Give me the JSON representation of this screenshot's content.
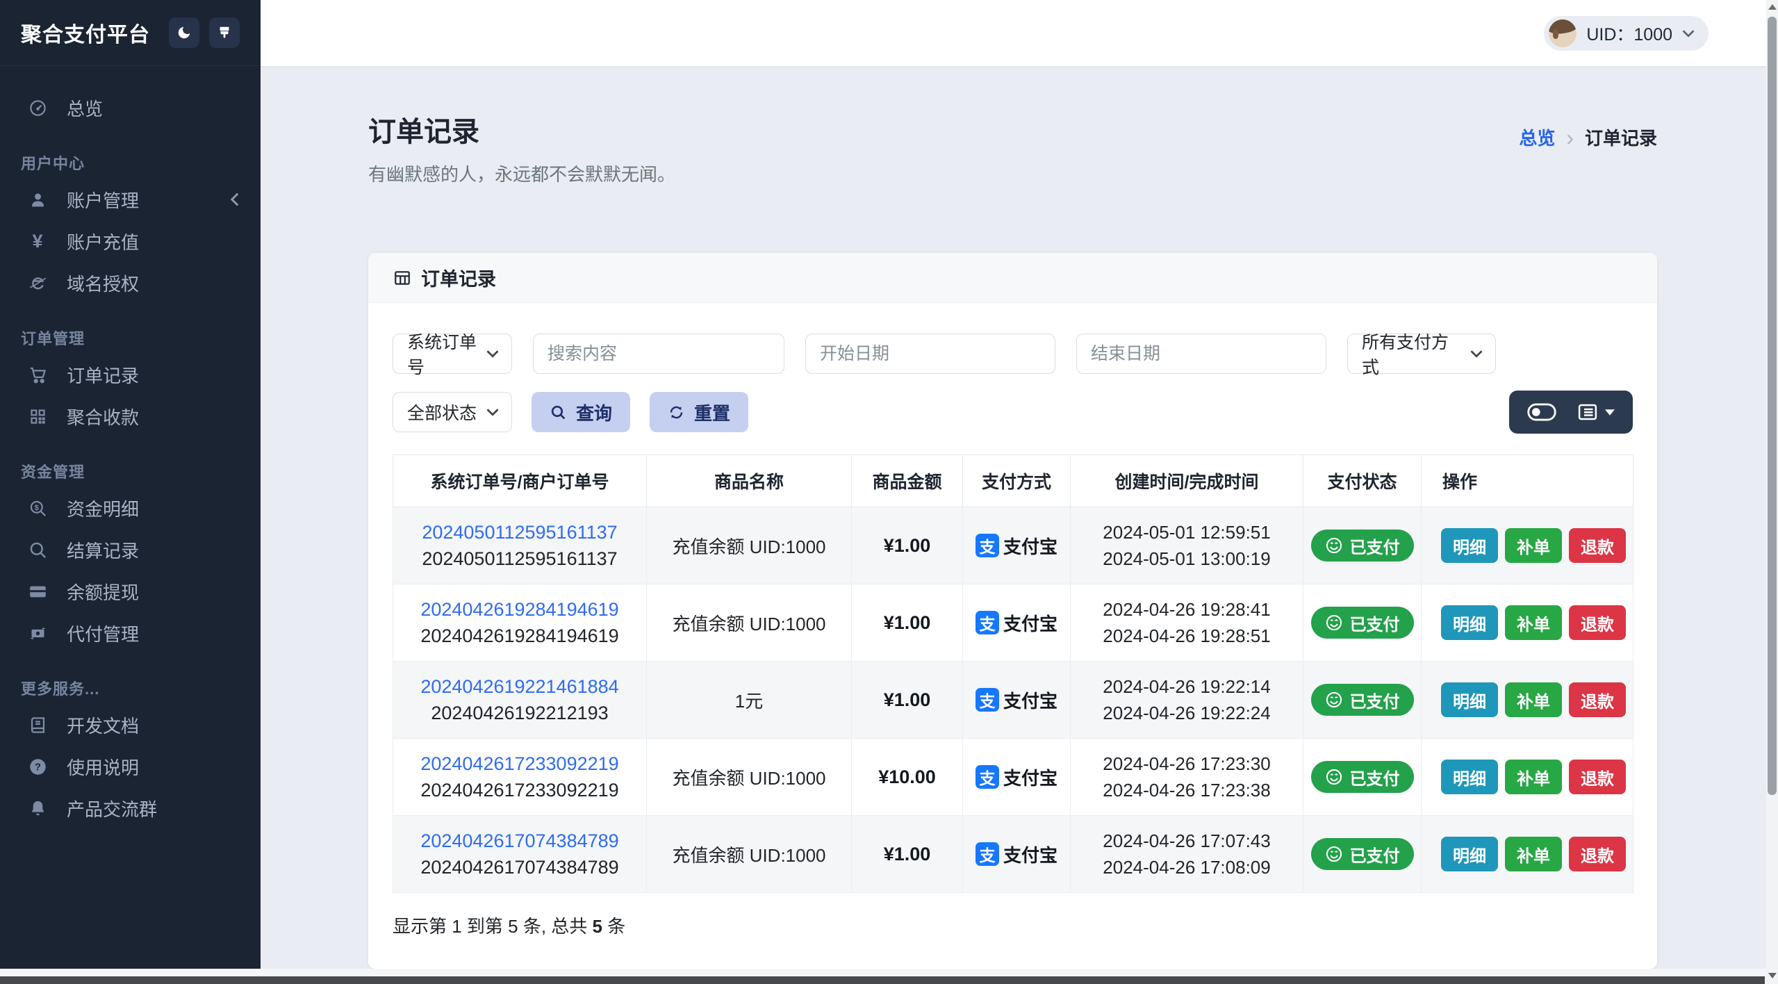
{
  "app": {
    "title": "聚合支付平台"
  },
  "topbar": {
    "uid_label": "UID：1000"
  },
  "sidebar": {
    "sections": [
      {
        "label": "",
        "items": [
          {
            "id": "overview",
            "icon": "gauge-icon",
            "label": "总览"
          }
        ]
      },
      {
        "label": "用户中心",
        "items": [
          {
            "id": "account-management",
            "icon": "user-icon",
            "label": "账户管理",
            "collapsible": true
          },
          {
            "id": "account-recharge",
            "icon": "yen-icon",
            "label": "账户充值"
          },
          {
            "id": "domain-authorization",
            "icon": "globe-icon",
            "label": "域名授权"
          }
        ]
      },
      {
        "label": "订单管理",
        "items": [
          {
            "id": "order-records",
            "icon": "cart-icon",
            "label": "订单记录"
          },
          {
            "id": "aggregate-collection",
            "icon": "qrcode-icon",
            "label": "聚合收款"
          }
        ]
      },
      {
        "label": "资金管理",
        "items": [
          {
            "id": "funds-detail",
            "icon": "search-dollar-icon",
            "label": "资金明细"
          },
          {
            "id": "settlement-records",
            "icon": "search-icon",
            "label": "结算记录"
          },
          {
            "id": "balance-withdrawal",
            "icon": "card-icon",
            "label": "余额提现"
          },
          {
            "id": "payout-management",
            "icon": "transfer-icon",
            "label": "代付管理"
          }
        ]
      },
      {
        "label": "更多服务...",
        "items": [
          {
            "id": "dev-docs",
            "icon": "book-icon",
            "label": "开发文档"
          },
          {
            "id": "usage-guide",
            "icon": "question-icon",
            "label": "使用说明"
          },
          {
            "id": "product-chat-group",
            "icon": "bell-icon",
            "label": "产品交流群"
          }
        ]
      }
    ]
  },
  "page": {
    "title": "订单记录",
    "subtitle": "有幽默感的人，永远都不会默默无闻。",
    "breadcrumb_parent": "总览",
    "breadcrumb_current": "订单记录"
  },
  "card": {
    "title": "订单记录"
  },
  "filters": {
    "search_type": "系统订单号",
    "search_placeholder": "搜索内容",
    "start_date_placeholder": "开始日期",
    "end_date_placeholder": "结束日期",
    "pay_method": "所有支付方式",
    "status": "全部状态",
    "query_label": "查询",
    "reset_label": "重置"
  },
  "table": {
    "headers": [
      "系统订单号/商户订单号",
      "商品名称",
      "商品金额",
      "支付方式",
      "创建时间/完成时间",
      "支付状态",
      "操作"
    ],
    "rows": [
      {
        "sys_no": "2024050112595161137",
        "merchant_no": "2024050112595161137",
        "product": "充值余额 UID:1000",
        "amount": "¥1.00",
        "method": "支付宝",
        "created": "2024-05-01 12:59:51",
        "completed": "2024-05-01 13:00:19",
        "status": "已支付"
      },
      {
        "sys_no": "2024042619284194619",
        "merchant_no": "2024042619284194619",
        "product": "充值余额 UID:1000",
        "amount": "¥1.00",
        "method": "支付宝",
        "created": "2024-04-26 19:28:41",
        "completed": "2024-04-26 19:28:51",
        "status": "已支付"
      },
      {
        "sys_no": "2024042619221461884",
        "merchant_no": "20240426192212193",
        "product": "1元",
        "amount": "¥1.00",
        "method": "支付宝",
        "created": "2024-04-26 19:22:14",
        "completed": "2024-04-26 19:22:24",
        "status": "已支付"
      },
      {
        "sys_no": "2024042617233092219",
        "merchant_no": "2024042617233092219",
        "product": "充值余额 UID:1000",
        "amount": "¥10.00",
        "method": "支付宝",
        "created": "2024-04-26 17:23:30",
        "completed": "2024-04-26 17:23:38",
        "status": "已支付"
      },
      {
        "sys_no": "2024042617074384789",
        "merchant_no": "2024042617074384789",
        "product": "充值余额 UID:1000",
        "amount": "¥1.00",
        "method": "支付宝",
        "created": "2024-04-26 17:07:43",
        "completed": "2024-04-26 17:08:09",
        "status": "已支付"
      }
    ],
    "actions": [
      "明细",
      "补单",
      "退款"
    ],
    "alipay_glyph": "支",
    "footer": {
      "prefix": "显示第 1 到第 5 条, 总共 ",
      "total": "5",
      "suffix": " 条"
    }
  },
  "colors": {
    "sidebar_bg": "#1b2433",
    "accent_blue": "#2563eb",
    "order_link_blue": "#2e6cf0",
    "success_green": "#23a14b",
    "info_teal": "#1f97ba",
    "danger_red": "#dc3545",
    "alipay_blue": "#1677ff",
    "soft_button_bg": "#c5cff0",
    "soft_button_text": "#1d2f66",
    "toolbar_dark": "#2c3a4f"
  }
}
